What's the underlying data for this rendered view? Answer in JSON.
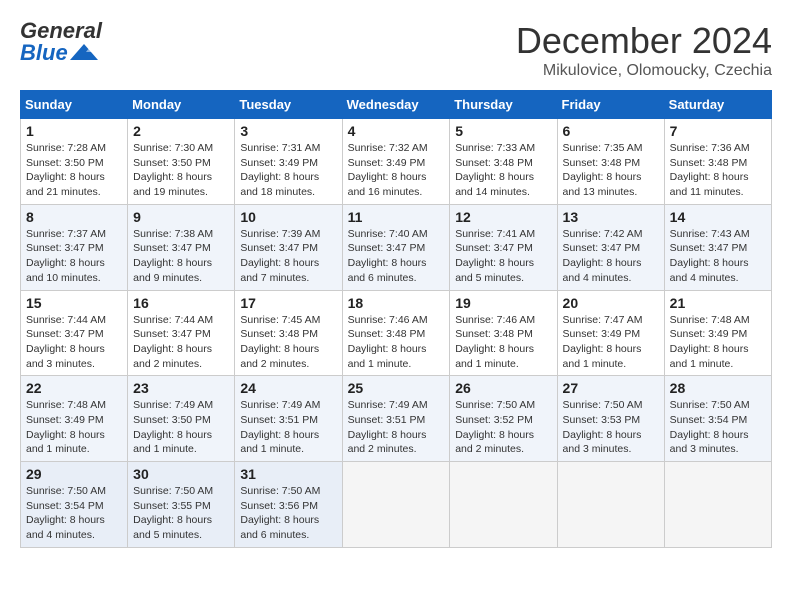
{
  "header": {
    "logo_general": "General",
    "logo_blue": "Blue",
    "month_title": "December 2024",
    "location": "Mikulovice, Olomoucky, Czechia"
  },
  "days_of_week": [
    "Sunday",
    "Monday",
    "Tuesday",
    "Wednesday",
    "Thursday",
    "Friday",
    "Saturday"
  ],
  "weeks": [
    [
      {
        "day": "1",
        "sunrise": "Sunrise: 7:28 AM",
        "sunset": "Sunset: 3:50 PM",
        "daylight": "Daylight: 8 hours and 21 minutes."
      },
      {
        "day": "2",
        "sunrise": "Sunrise: 7:30 AM",
        "sunset": "Sunset: 3:50 PM",
        "daylight": "Daylight: 8 hours and 19 minutes."
      },
      {
        "day": "3",
        "sunrise": "Sunrise: 7:31 AM",
        "sunset": "Sunset: 3:49 PM",
        "daylight": "Daylight: 8 hours and 18 minutes."
      },
      {
        "day": "4",
        "sunrise": "Sunrise: 7:32 AM",
        "sunset": "Sunset: 3:49 PM",
        "daylight": "Daylight: 8 hours and 16 minutes."
      },
      {
        "day": "5",
        "sunrise": "Sunrise: 7:33 AM",
        "sunset": "Sunset: 3:48 PM",
        "daylight": "Daylight: 8 hours and 14 minutes."
      },
      {
        "day": "6",
        "sunrise": "Sunrise: 7:35 AM",
        "sunset": "Sunset: 3:48 PM",
        "daylight": "Daylight: 8 hours and 13 minutes."
      },
      {
        "day": "7",
        "sunrise": "Sunrise: 7:36 AM",
        "sunset": "Sunset: 3:48 PM",
        "daylight": "Daylight: 8 hours and 11 minutes."
      }
    ],
    [
      {
        "day": "8",
        "sunrise": "Sunrise: 7:37 AM",
        "sunset": "Sunset: 3:47 PM",
        "daylight": "Daylight: 8 hours and 10 minutes."
      },
      {
        "day": "9",
        "sunrise": "Sunrise: 7:38 AM",
        "sunset": "Sunset: 3:47 PM",
        "daylight": "Daylight: 8 hours and 9 minutes."
      },
      {
        "day": "10",
        "sunrise": "Sunrise: 7:39 AM",
        "sunset": "Sunset: 3:47 PM",
        "daylight": "Daylight: 8 hours and 7 minutes."
      },
      {
        "day": "11",
        "sunrise": "Sunrise: 7:40 AM",
        "sunset": "Sunset: 3:47 PM",
        "daylight": "Daylight: 8 hours and 6 minutes."
      },
      {
        "day": "12",
        "sunrise": "Sunrise: 7:41 AM",
        "sunset": "Sunset: 3:47 PM",
        "daylight": "Daylight: 8 hours and 5 minutes."
      },
      {
        "day": "13",
        "sunrise": "Sunrise: 7:42 AM",
        "sunset": "Sunset: 3:47 PM",
        "daylight": "Daylight: 8 hours and 4 minutes."
      },
      {
        "day": "14",
        "sunrise": "Sunrise: 7:43 AM",
        "sunset": "Sunset: 3:47 PM",
        "daylight": "Daylight: 8 hours and 4 minutes."
      }
    ],
    [
      {
        "day": "15",
        "sunrise": "Sunrise: 7:44 AM",
        "sunset": "Sunset: 3:47 PM",
        "daylight": "Daylight: 8 hours and 3 minutes."
      },
      {
        "day": "16",
        "sunrise": "Sunrise: 7:44 AM",
        "sunset": "Sunset: 3:47 PM",
        "daylight": "Daylight: 8 hours and 2 minutes."
      },
      {
        "day": "17",
        "sunrise": "Sunrise: 7:45 AM",
        "sunset": "Sunset: 3:48 PM",
        "daylight": "Daylight: 8 hours and 2 minutes."
      },
      {
        "day": "18",
        "sunrise": "Sunrise: 7:46 AM",
        "sunset": "Sunset: 3:48 PM",
        "daylight": "Daylight: 8 hours and 1 minute."
      },
      {
        "day": "19",
        "sunrise": "Sunrise: 7:46 AM",
        "sunset": "Sunset: 3:48 PM",
        "daylight": "Daylight: 8 hours and 1 minute."
      },
      {
        "day": "20",
        "sunrise": "Sunrise: 7:47 AM",
        "sunset": "Sunset: 3:49 PM",
        "daylight": "Daylight: 8 hours and 1 minute."
      },
      {
        "day": "21",
        "sunrise": "Sunrise: 7:48 AM",
        "sunset": "Sunset: 3:49 PM",
        "daylight": "Daylight: 8 hours and 1 minute."
      }
    ],
    [
      {
        "day": "22",
        "sunrise": "Sunrise: 7:48 AM",
        "sunset": "Sunset: 3:49 PM",
        "daylight": "Daylight: 8 hours and 1 minute."
      },
      {
        "day": "23",
        "sunrise": "Sunrise: 7:49 AM",
        "sunset": "Sunset: 3:50 PM",
        "daylight": "Daylight: 8 hours and 1 minute."
      },
      {
        "day": "24",
        "sunrise": "Sunrise: 7:49 AM",
        "sunset": "Sunset: 3:51 PM",
        "daylight": "Daylight: 8 hours and 1 minute."
      },
      {
        "day": "25",
        "sunrise": "Sunrise: 7:49 AM",
        "sunset": "Sunset: 3:51 PM",
        "daylight": "Daylight: 8 hours and 2 minutes."
      },
      {
        "day": "26",
        "sunrise": "Sunrise: 7:50 AM",
        "sunset": "Sunset: 3:52 PM",
        "daylight": "Daylight: 8 hours and 2 minutes."
      },
      {
        "day": "27",
        "sunrise": "Sunrise: 7:50 AM",
        "sunset": "Sunset: 3:53 PM",
        "daylight": "Daylight: 8 hours and 3 minutes."
      },
      {
        "day": "28",
        "sunrise": "Sunrise: 7:50 AM",
        "sunset": "Sunset: 3:54 PM",
        "daylight": "Daylight: 8 hours and 3 minutes."
      }
    ],
    [
      {
        "day": "29",
        "sunrise": "Sunrise: 7:50 AM",
        "sunset": "Sunset: 3:54 PM",
        "daylight": "Daylight: 8 hours and 4 minutes."
      },
      {
        "day": "30",
        "sunrise": "Sunrise: 7:50 AM",
        "sunset": "Sunset: 3:55 PM",
        "daylight": "Daylight: 8 hours and 5 minutes."
      },
      {
        "day": "31",
        "sunrise": "Sunrise: 7:50 AM",
        "sunset": "Sunset: 3:56 PM",
        "daylight": "Daylight: 8 hours and 6 minutes."
      },
      null,
      null,
      null,
      null
    ]
  ]
}
